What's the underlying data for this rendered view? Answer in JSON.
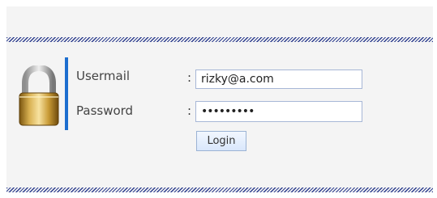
{
  "form": {
    "usermail_label": "Usermail",
    "password_label": "Password",
    "separator": ":",
    "usermail_value": "rizky@a.com",
    "password_value": "•••••••••",
    "login_label": "Login"
  },
  "icons": {
    "lock": "lock-icon"
  },
  "colors": {
    "accent": "#1d6ecf",
    "stripe": "#2e3f8f",
    "input_border": "#a7b7d6",
    "button_top": "#f2f7ff",
    "button_bottom": "#d9e7fb"
  }
}
